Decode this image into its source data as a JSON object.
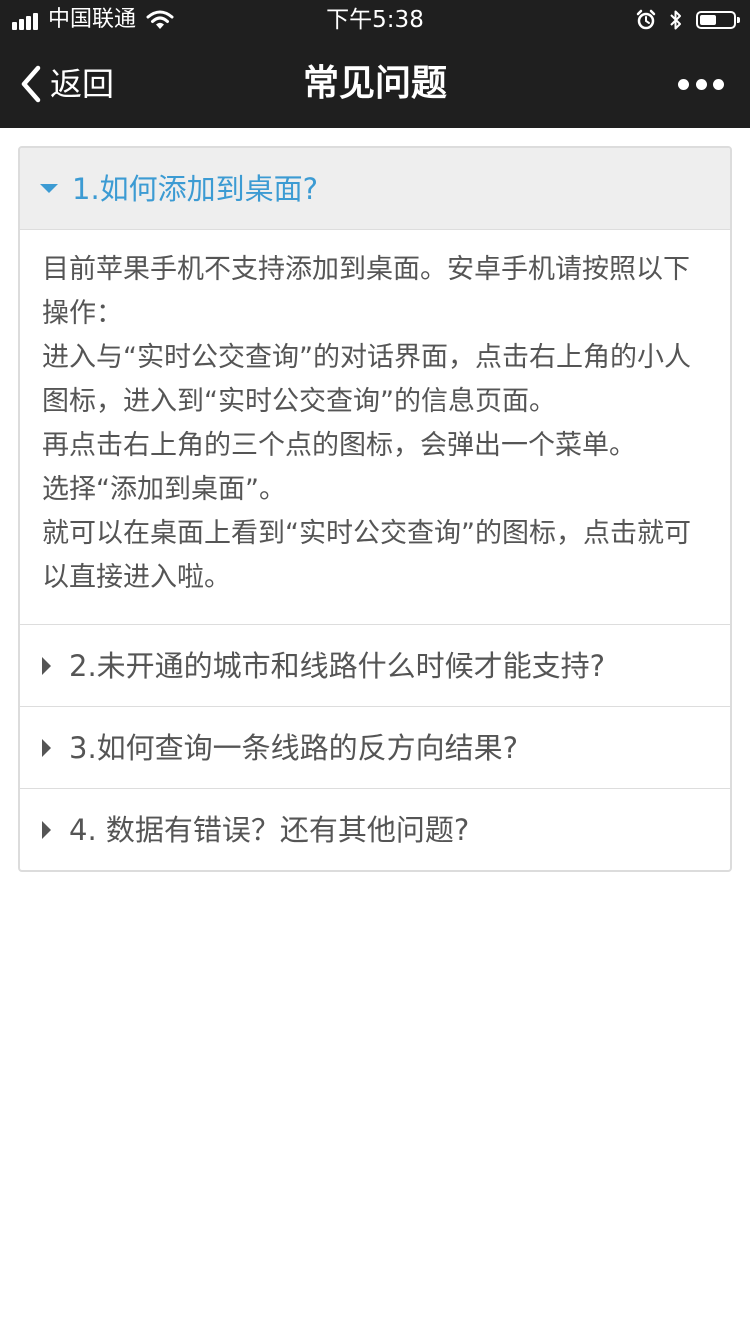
{
  "status_bar": {
    "carrier": "中国联通",
    "time": "下午5:38",
    "battery_level": 0.45,
    "icons": [
      "signal-icon",
      "wifi-icon",
      "alarm-icon",
      "bluetooth-icon",
      "battery-icon"
    ]
  },
  "nav": {
    "back_label": "返回",
    "title": "常见问题",
    "icons": [
      "chevron-left-icon",
      "more-icon"
    ]
  },
  "faq": {
    "accent_color": "#3c9bd3",
    "items": [
      {
        "question": "1.如何添加到桌面?",
        "expanded": true,
        "answer": [
          "目前苹果手机不支持添加到桌面。安卓手机请按照以下操作：",
          "进入与“实时公交查询”的对话界面，点击右上角的小人图标，进入到“实时公交查询”的信息页面。",
          "再点击右上角的三个点的图标，会弹出一个菜单。",
          "选择“添加到桌面”。",
          "就可以在桌面上看到“实时公交查询”的图标，点击就可以直接进入啦。"
        ]
      },
      {
        "question": "2.未开通的城市和线路什么时候才能支持?",
        "expanded": false
      },
      {
        "question": "3.如何查询一条线路的反方向结果?",
        "expanded": false
      },
      {
        "question": "4. 数据有错误？还有其他问题?",
        "expanded": false
      }
    ]
  }
}
